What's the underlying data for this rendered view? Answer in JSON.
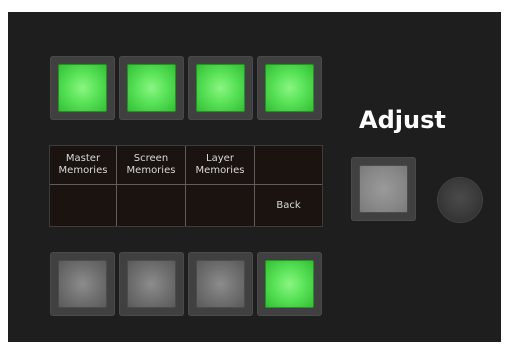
{
  "display": {
    "top_row": [
      "Master\nMemories",
      "Screen\nMemories",
      "Layer\nMemories",
      ""
    ],
    "bottom_row": [
      "",
      "",
      "",
      "Back"
    ]
  },
  "adjust": {
    "title": "Adjust"
  },
  "colors": {
    "panel_background": "#1e1e1e",
    "key_lit_green": "#5be35a",
    "key_unlit_gray": "#6f6f6f",
    "title_text": "#ffffff"
  },
  "keys": {
    "top_row_state": [
      "lit",
      "lit",
      "lit",
      "lit"
    ],
    "bottom_row_state": [
      "unlit",
      "unlit",
      "unlit",
      "lit"
    ],
    "adjust_key_state": "unlit"
  }
}
